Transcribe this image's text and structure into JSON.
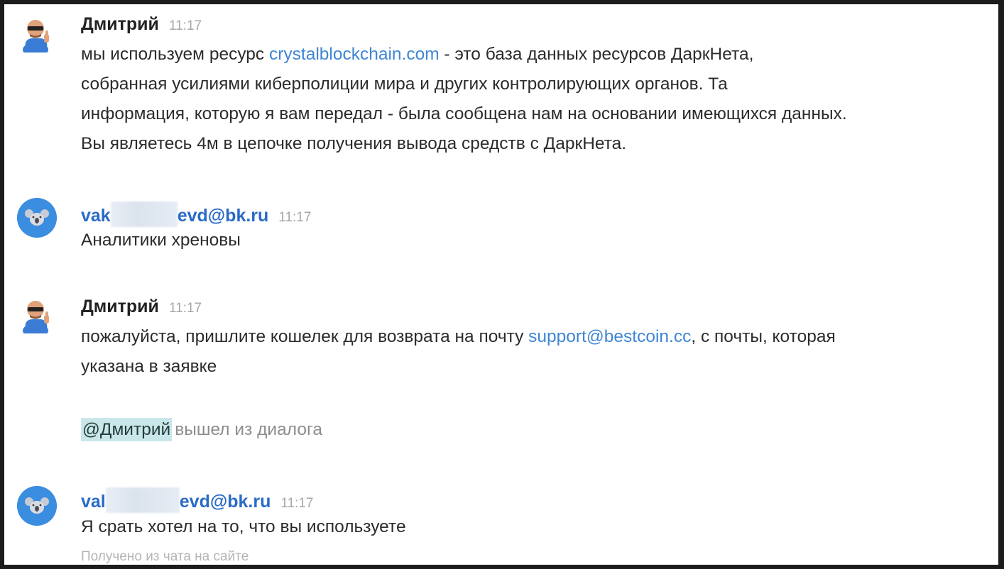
{
  "messages": [
    {
      "author": "Дмитрий",
      "time": "11:17",
      "lines": [
        {
          "pre": "мы используем ресурс ",
          "link": "crystalblockchain.com",
          "post": " - это база данных ресурсов ДаркНета,"
        },
        {
          "text": "собранная усилиями киберполиции мира и других контролирующих органов. Та"
        },
        {
          "text": "информация, которую я вам передал - была сообщена нам на основании имеющихся данных."
        },
        {
          "text": "Вы являетесь 4м в цепочке получения вывода средств с ДаркНета."
        }
      ]
    },
    {
      "author_start": "vak",
      "author_end": "evd@bk.ru",
      "time": "11:17",
      "text": "Аналитики хреновы"
    },
    {
      "author": "Дмитрий",
      "time": "11:17",
      "lines": [
        {
          "pre": "пожалуйста, пришлите кошелек для возврата на почту ",
          "link": "support@bestcoin.cc",
          "post": ", с почты, которая"
        },
        {
          "text": "указана в заявке"
        }
      ]
    },
    {
      "author_start": "val",
      "author_end": "evd@bk.ru",
      "time": "11:17",
      "text": "Я срать хотел на то, что вы используете",
      "source": "Получено из чата на сайте"
    }
  ],
  "system_event": {
    "mention": "@Дмитрий",
    "text": "вышел из диалога"
  },
  "colors": {
    "link": "#3f86d4",
    "email_author": "#2a6bc7",
    "mention_bg": "#c9e7e8",
    "koala_avatar": "#3b8de0"
  },
  "icons": {
    "agent_avatar": "bald-man-sunglasses-thumbs-up-icon",
    "visitor_avatar": "koala-icon"
  }
}
